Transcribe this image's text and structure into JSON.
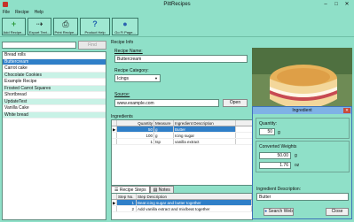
{
  "window": {
    "title": "PittRecipes",
    "min": "–",
    "max": "□",
    "close": "✕"
  },
  "menu": [
    "File",
    "Recipe",
    "Help"
  ],
  "toolbar": [
    {
      "label": "Add Recipe...",
      "icon": "plus-icon",
      "glyph": "+",
      "color": "#2e9a3c"
    },
    {
      "label": "Export Text...",
      "icon": "export-icon",
      "glyph": "⇢",
      "color": "#333"
    },
    {
      "label": "Print Recipe...",
      "icon": "printer-icon",
      "glyph": "⎙",
      "color": "#333"
    },
    {
      "label": "Product Help",
      "icon": "help-icon",
      "glyph": "?",
      "color": "#1d5fae"
    },
    {
      "label": "Go Fi Page...",
      "icon": "globe-icon",
      "glyph": "●",
      "color": "#2b62b0"
    }
  ],
  "search": {
    "value": "",
    "find_label": "Find"
  },
  "recipes": [
    "Bread rolls",
    "Buttercream",
    "Carrot cake",
    "Chocolate Cookies",
    "Example Recipe",
    "Frosted Carrot Squares",
    "Shortbread",
    "UpdateTest",
    "Vanilla Cake",
    "White bread"
  ],
  "selected_recipe": "Buttercream",
  "recipe_info": {
    "section_label": "Recipe Info",
    "name_label": "Recipe Name:",
    "name_value": "Buttercream",
    "category_label": "Recipe Category:",
    "category_value": "Icings",
    "source_label": "Source:",
    "source_value": "www.example.com",
    "open_label": "Open"
  },
  "ingredients": {
    "section_label": "Ingredients",
    "columns": [
      "Quantity",
      "Measure",
      "Ingredient Description"
    ],
    "rows": [
      {
        "qty": "50",
        "measure": "g",
        "desc": "Butter"
      },
      {
        "qty": "100",
        "measure": "g",
        "desc": "Icing sugar"
      },
      {
        "qty": "1",
        "measure": "tsp",
        "desc": "vanilla extract"
      }
    ]
  },
  "steps": {
    "tabs": [
      "Recipe Steps",
      "Notes"
    ],
    "columns": [
      "Step No.",
      "Step Description"
    ],
    "rows": [
      {
        "no": "1",
        "desc": "Beat icing sugar and butter together"
      },
      {
        "no": "2",
        "desc": "Add vanilla extract and mix/beat together"
      }
    ]
  },
  "dialog": {
    "title": "Ingredient",
    "close": "✕",
    "quantity_label": "Quantity:",
    "quantity_value": "50",
    "quantity_unit": "g",
    "converted_label": "Converted Weights",
    "conv1_value": "50.00",
    "conv1_unit": "g",
    "conv2_value": "1.76",
    "conv2_unit": "oz",
    "desc_label": "Ingredient Description:",
    "desc_value": "Butter",
    "search_web_label": "Search Web",
    "close_label": "Close"
  }
}
